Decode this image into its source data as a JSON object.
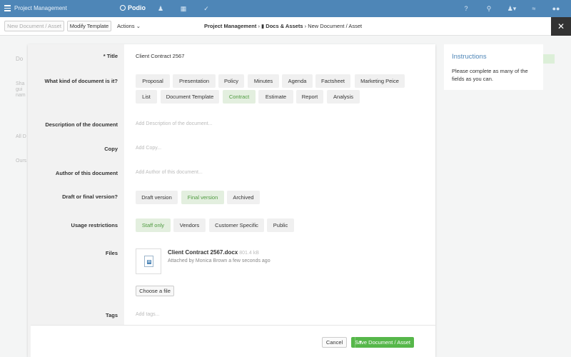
{
  "topbar": {
    "workspace": "Project Management",
    "logo": "Podio",
    "icons": [
      "menu-icon",
      "contacts-icon",
      "calendar-icon",
      "tasks-icon",
      "help-icon",
      "search-icon",
      "user-menu-icon",
      "rss-icon",
      "chat-icon"
    ]
  },
  "toolbar": {
    "new_btn": "New Document / Asset",
    "modify_btn": "Modify Template",
    "actions": "Actions",
    "crumb": [
      "Project Management",
      "Docs & Assets",
      "New Document / Asset"
    ]
  },
  "form": {
    "title": {
      "label": "Title",
      "required_mark": "*",
      "value": "Client Contract 2567"
    },
    "kind": {
      "label": "What kind of document is it?",
      "options": [
        "Proposal",
        "Presentation",
        "Policy",
        "Minutes",
        "Agenda",
        "Factsheet",
        "Marketing Peice",
        "List",
        "Document Template",
        "Contract",
        "Estimate",
        "Report",
        "Analysis"
      ],
      "selected": "Contract"
    },
    "description": {
      "label": "Description of the document",
      "placeholder": "Add Description of the document..."
    },
    "copy": {
      "label": "Copy",
      "placeholder": "Add Copy..."
    },
    "author": {
      "label": "Author of this document",
      "placeholder": "Add Author of this document..."
    },
    "draft": {
      "label": "Draft or final version?",
      "options": [
        "Draft version",
        "Final version",
        "Archived"
      ],
      "selected": "Final version"
    },
    "usage": {
      "label": "Usage restrictions",
      "options": [
        "Staff only",
        "Vendors",
        "Customer Specific",
        "Public"
      ],
      "selected": "Staff only"
    },
    "files": {
      "label": "Files",
      "name": "Client Contract 2567.docx",
      "size": "801.4 kB",
      "meta": "Attached by Monica Brown a few seconds ago",
      "choose": "Choose a file"
    },
    "tags": {
      "label": "Tags",
      "placeholder": "Add tags..."
    }
  },
  "footer": {
    "cancel": "Cancel",
    "save": "Save Document / Asset"
  },
  "instructions": {
    "heading": "Instructions",
    "text": "Please complete as many of the fields as you can."
  },
  "colors": {
    "header": "#4e86b7",
    "accent_green": "#56b74a",
    "selected_chip": "#e3efdf"
  }
}
